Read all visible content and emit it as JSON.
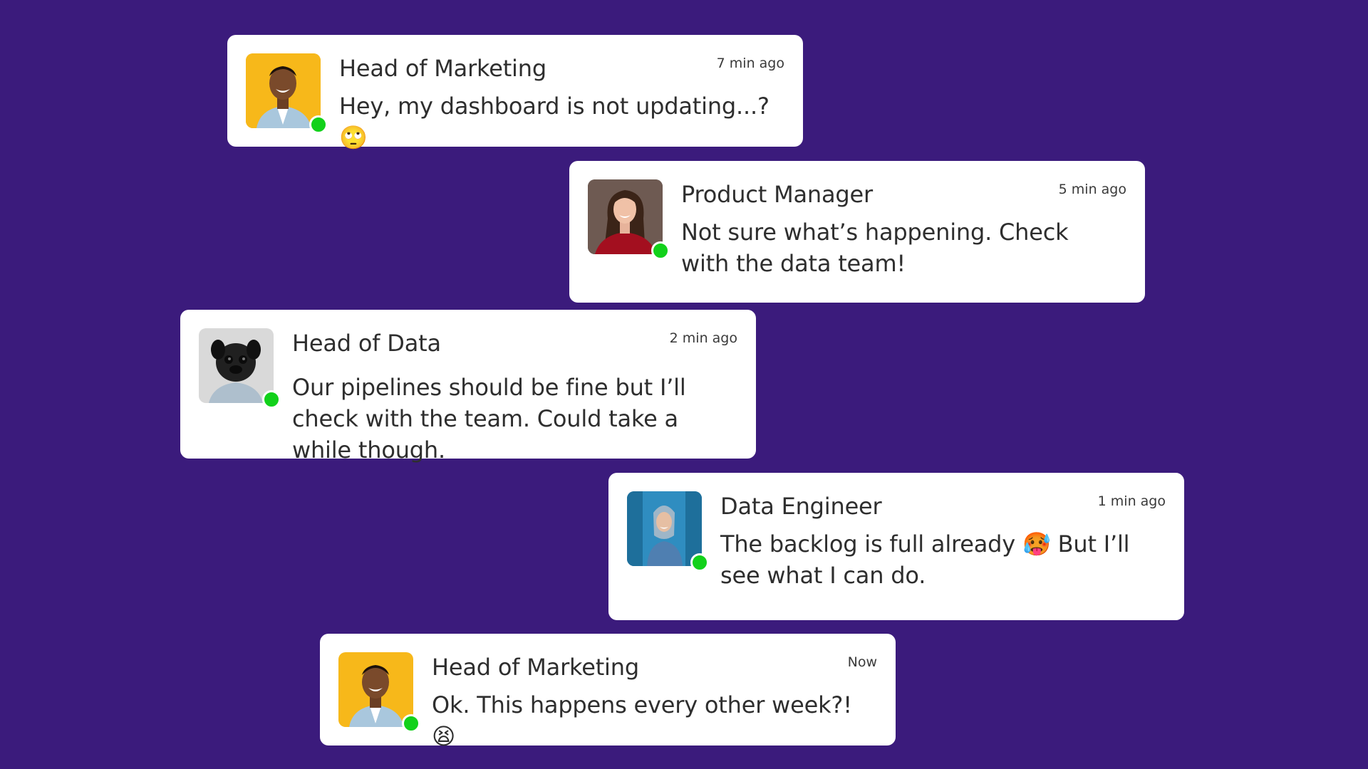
{
  "messages": [
    {
      "sender": "Head of Marketing",
      "time": "7 min ago",
      "text": "Hey, my dashboard is not updating...? 🙄",
      "avatar": "man-smiling-yellow-background",
      "status": "online"
    },
    {
      "sender": "Product Manager",
      "time": "5 min ago",
      "text": "Not sure what’s happening. Check with the data team!",
      "avatar": "woman-red-sweater",
      "status": "online"
    },
    {
      "sender": "Head of Data",
      "time": "2 min ago",
      "text": "Our pipelines should be fine but I’ll check with the team. Could take a while though.",
      "avatar": "pug-dog",
      "status": "online"
    },
    {
      "sender": "Data Engineer",
      "time": "1 min ago",
      "text": "The backlog is full already 🥵 But I’ll see what I can do.",
      "avatar": "woman-blue-hoodie",
      "status": "online"
    },
    {
      "sender": "Head of Marketing",
      "time": "Now",
      "text": "Ok. This happens every other week?! 😫",
      "avatar": "man-smiling-yellow-background",
      "status": "online"
    }
  ],
  "colors": {
    "background": "#3b1b7c",
    "card": "#ffffff",
    "online": "#12d11b"
  }
}
